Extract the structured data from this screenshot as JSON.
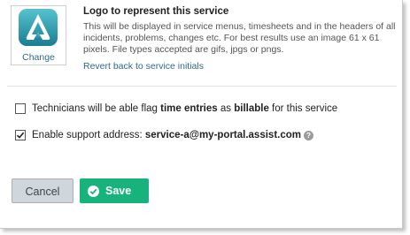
{
  "logo": {
    "change_label": "Change",
    "title": "Logo to represent this service",
    "description": "This will be displayed in service menus, timesheets and in the headers of all incidents, problems, changes etc. For best results use an image 61 x 61 pixels. File types accepted are gifs, jpgs or pngs.",
    "revert_label": "Revert back to service initials"
  },
  "options": {
    "billable": {
      "checked": false,
      "text_before": "Technicians will be able flag ",
      "bold1": "time entries",
      "text_mid": " as ",
      "bold2": "billable",
      "text_after": " for this service"
    },
    "support": {
      "checked": true,
      "text_before": "Enable support address: ",
      "address": "service-a@my-portal.assist.com",
      "help_glyph": "?"
    }
  },
  "buttons": {
    "cancel_label": "Cancel",
    "save_label": "Save"
  },
  "colors": {
    "accent_green": "#16b37c",
    "link_blue": "#2d6a8f",
    "logo_teal": "#2b9bb0"
  }
}
